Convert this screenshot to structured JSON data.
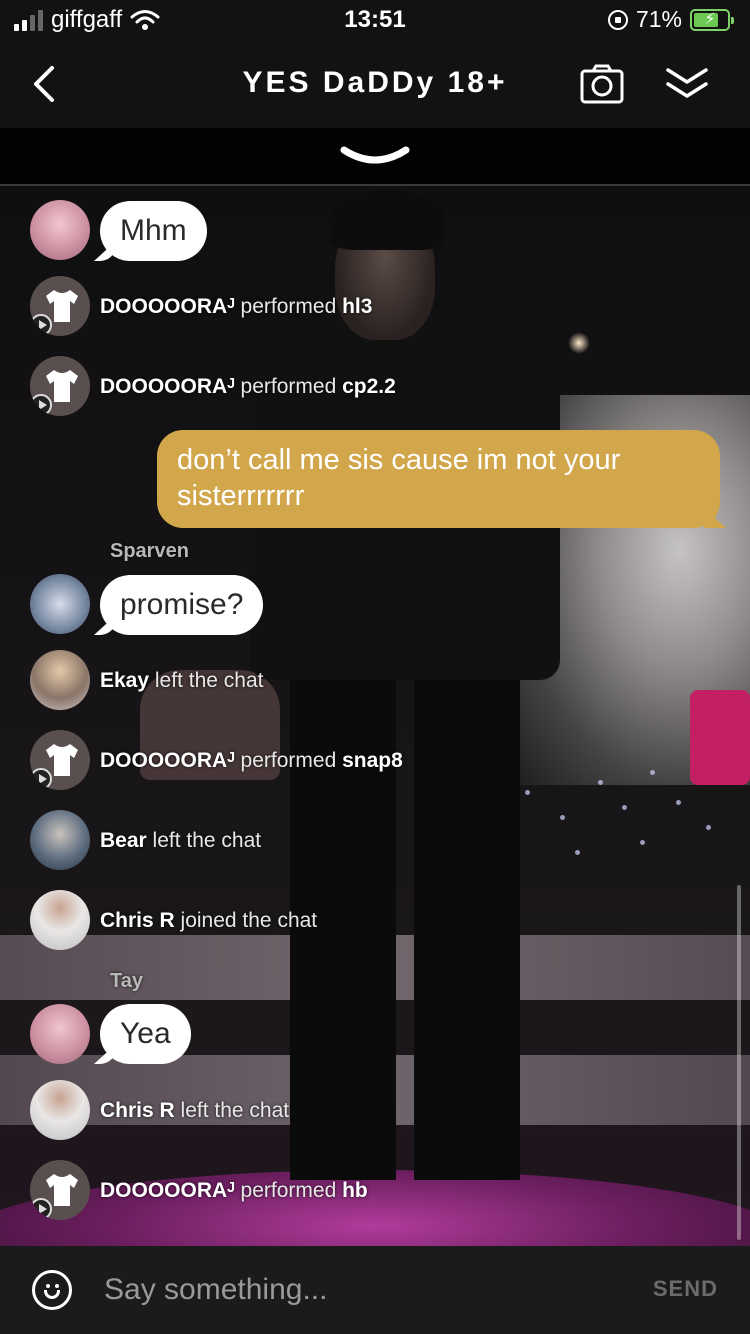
{
  "status_bar": {
    "carrier": "giffgaff",
    "time": "13:51",
    "battery_percent": "71%",
    "battery_level": 0.71
  },
  "nav": {
    "title": "YES DaDDy 18+",
    "icons": [
      "back-chevron-icon",
      "camera-icon",
      "double-chevron-down-icon"
    ]
  },
  "messages": [
    {
      "type": "bubble",
      "text": "Mhm"
    },
    {
      "type": "system",
      "name": "DOOOOORAᴶ",
      "action": "performed",
      "item": "hl3"
    },
    {
      "type": "system",
      "name": "DOOOOORAᴶ",
      "action": "performed",
      "item": "cp2.2"
    },
    {
      "type": "mine",
      "text": "don’t call me sis cause im not your sisterrrrrrr"
    },
    {
      "type": "bubble",
      "sender": "Sparven",
      "text": "promise?"
    },
    {
      "type": "system",
      "name": "Ekay",
      "action": "left the chat"
    },
    {
      "type": "system",
      "name": "DOOOOORAᴶ",
      "action": "performed",
      "item": "snap8"
    },
    {
      "type": "system",
      "name": "Bear",
      "action": "left the chat"
    },
    {
      "type": "system",
      "name": "Chris R",
      "action": "joined the chat"
    },
    {
      "type": "bubble",
      "sender": "Tay",
      "text": "Yea"
    },
    {
      "type": "system",
      "name": "Chris R",
      "action": "left the chat"
    },
    {
      "type": "system",
      "name": "DOOOOORAᴶ",
      "action": "performed",
      "item": "hb"
    }
  ],
  "input": {
    "placeholder": "Say something...",
    "value": "",
    "send_label": "SEND"
  },
  "colors": {
    "own_bubble": "#d2a74c",
    "other_bubble": "#ffffff",
    "battery": "#6cc954"
  }
}
